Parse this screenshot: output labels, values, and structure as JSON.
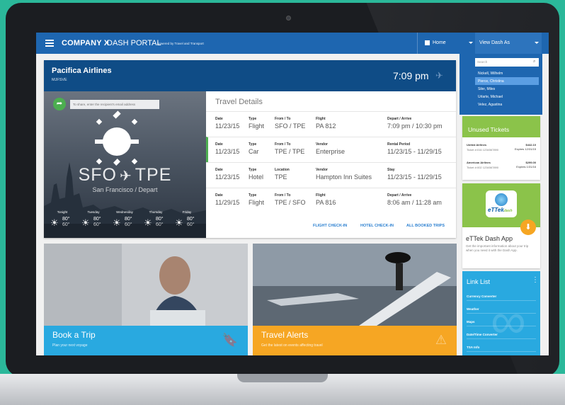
{
  "portal": {
    "brand": "COMPANY X",
    "product": "DASH PORTAL",
    "powered_by": "powered by Travel and Transport",
    "home_label": "Home",
    "view_as_label": "View Dash As",
    "search_placeholder": "Search",
    "users": [
      "Nickell, Wilhelm",
      "Pierce, Christina",
      "Siler, Miles",
      "Urlarte, Michael",
      "Velez, Agustina"
    ]
  },
  "flight": {
    "airline": "Pacifica Airlines",
    "confirmation": "MJFSVE",
    "time": "7:09 pm",
    "share_placeholder": "To share, enter the recipient's email address",
    "route_from": "SFO",
    "route_to": "TPE",
    "depart_label": "San Francisco / Depart",
    "forecast": [
      {
        "day": "Tonight",
        "hi": "80°",
        "lo": "60°"
      },
      {
        "day": "Tuesday",
        "hi": "80°",
        "lo": "60°"
      },
      {
        "day": "Wednesday",
        "hi": "80°",
        "lo": "60°"
      },
      {
        "day": "Thursday",
        "hi": "80°",
        "lo": "60°"
      },
      {
        "day": "Friday",
        "hi": "80°",
        "lo": "60°"
      }
    ]
  },
  "details": {
    "title": "Travel Details",
    "rows": [
      {
        "date": "11/23/15",
        "type": "Flight",
        "c3h": "From / To",
        "c3": "SFO / TPE",
        "c4h": "Flight",
        "c4": "PA 812",
        "c5h": "Depart / Arrive",
        "c5": "7:09 pm / 10:30 pm"
      },
      {
        "date": "11/23/15",
        "type": "Car",
        "c3h": "From / To",
        "c3": "TPE / TPE",
        "c4h": "Vendor",
        "c4": "Enterprise",
        "c5h": "Rental Period",
        "c5": "11/23/15 - 11/29/15"
      },
      {
        "date": "11/23/15",
        "type": "Hotel",
        "c3h": "Location",
        "c3": "TPE",
        "c4h": "Vendor",
        "c4": "Hampton Inn Suites",
        "c5h": "Stay",
        "c5": "11/23/15 - 11/29/15"
      },
      {
        "date": "11/29/15",
        "type": "Flight",
        "c3h": "From / To",
        "c3": "TPE / SFO",
        "c4h": "Flight",
        "c4": "PA 816",
        "c5h": "Depart / Arrive",
        "c5": "8:06 am / 11:28 am"
      }
    ],
    "date_h": "Date",
    "type_h": "Type",
    "links": [
      "FLIGHT CHECK-IN",
      "HOTEL CHECK-IN",
      "ALL BOOKED TRIPS"
    ]
  },
  "tickets": {
    "title": "Unused Tickets",
    "items": [
      {
        "airline": "United Airlines",
        "amount": "$442.10",
        "ticket": "Ticket #:016 1234567890",
        "expires": "Expires 12/31/15"
      },
      {
        "airline": "American Airlines",
        "amount": "$299.00",
        "ticket": "Ticket #:002 1234567890",
        "expires": "Expires 1/31/16"
      }
    ]
  },
  "app": {
    "logo_main": "eTTek",
    "logo_sub": "dash",
    "title": "eTTek Dash App",
    "desc": "Get the important information about your trip when you need it with the Dash App."
  },
  "linklist": {
    "title": "Link List",
    "items": [
      "Currency Converter",
      "Weather",
      "Maps",
      "Date/Time Converter",
      "TSA Info"
    ]
  },
  "tiles": {
    "book_title": "Book a Trip",
    "book_sub": "Plan your next voyage",
    "alerts_title": "Travel Alerts",
    "alerts_sub": "Get the latest on events affecting travel"
  },
  "colors": {
    "topbar": "#1e66b0",
    "green": "#8bc34a",
    "blue_tile": "#29a9e0",
    "orange_tile": "#f6a623"
  }
}
